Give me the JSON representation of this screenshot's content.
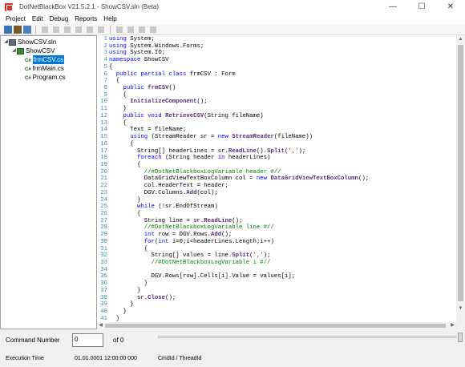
{
  "window": {
    "title": "DotNetBlackBox V21.5.2.1 - ShowCSV.sln (Beta)",
    "controls": {
      "minimize": "—",
      "maximize": "☐",
      "close": "✕"
    }
  },
  "menu": [
    "Project",
    "Edit",
    "Debug",
    "Reports",
    "Help"
  ],
  "toolbar": {
    "buttons": [
      {
        "name": "project-icon",
        "enabled": true
      },
      {
        "name": "open-folder-icon",
        "enabled": true
      },
      {
        "name": "export-icon",
        "enabled": true
      },
      {
        "name": "play-icon",
        "enabled": false
      },
      {
        "name": "step-icon",
        "enabled": false
      },
      {
        "name": "record-icon",
        "enabled": false
      },
      {
        "name": "step-over-icon",
        "enabled": false
      },
      {
        "name": "step-into-icon",
        "enabled": false
      },
      {
        "name": "step-out-icon",
        "enabled": false
      },
      {
        "name": "bookmark-icon",
        "enabled": false
      },
      {
        "name": "filter-icon",
        "enabled": false
      },
      {
        "name": "window-icon",
        "enabled": false
      },
      {
        "name": "pause-icon",
        "enabled": false
      }
    ]
  },
  "tree": {
    "nodes": [
      {
        "label": "ShowCSV.sln",
        "depth": 0,
        "type": "solution",
        "expander": "◢"
      },
      {
        "label": "ShowCSV",
        "depth": 1,
        "type": "project",
        "expander": "◢"
      },
      {
        "label": "frmCSV.cs",
        "depth": 2,
        "type": "cs",
        "selected": true
      },
      {
        "label": "frmMain.cs",
        "depth": 2,
        "type": "cs"
      },
      {
        "label": "Program.cs",
        "depth": 2,
        "type": "cs"
      }
    ]
  },
  "code": {
    "lines": [
      [
        [
          "kw",
          "using"
        ],
        [
          "nm",
          " System;"
        ]
      ],
      [
        [
          "kw",
          "using"
        ],
        [
          "nm",
          " System.Windows.Forms;"
        ]
      ],
      [
        [
          "kw",
          "using"
        ],
        [
          "nm",
          " System.IO;"
        ]
      ],
      [
        [
          "kw",
          "namespace"
        ],
        [
          "nm",
          " ShowCSV"
        ]
      ],
      [
        [
          "nm",
          "{"
        ]
      ],
      [
        [
          "nm",
          "  "
        ],
        [
          "kw",
          "public partial class"
        ],
        [
          "nm",
          " frmCSV : Form"
        ]
      ],
      [
        [
          "nm",
          "  {"
        ]
      ],
      [
        [
          "nm",
          "    "
        ],
        [
          "kw",
          "public"
        ],
        [
          "nm",
          " "
        ],
        [
          "fn",
          "frmCSV"
        ],
        [
          "nm",
          "()"
        ]
      ],
      [
        [
          "nm",
          "    {"
        ]
      ],
      [
        [
          "nm",
          "      "
        ],
        [
          "fn",
          "InitializeComponent"
        ],
        [
          "nm",
          "();"
        ]
      ],
      [
        [
          "nm",
          "    }"
        ]
      ],
      [
        [
          "nm",
          "    "
        ],
        [
          "kw",
          "public void"
        ],
        [
          "nm",
          " "
        ],
        [
          "fn",
          "RetrieveCSV"
        ],
        [
          "nm",
          "(String fileName)"
        ]
      ],
      [
        [
          "nm",
          "    {"
        ]
      ],
      [
        [
          "nm",
          "      Text = fileName;"
        ]
      ],
      [
        [
          "nm",
          "      "
        ],
        [
          "kw",
          "using"
        ],
        [
          "nm",
          " (StreamReader sr = "
        ],
        [
          "kw",
          "new"
        ],
        [
          "nm",
          " "
        ],
        [
          "fn",
          "StreamReader"
        ],
        [
          "nm",
          "(fileName))"
        ]
      ],
      [
        [
          "nm",
          "      {"
        ]
      ],
      [
        [
          "nm",
          "        String[] headerLines = sr."
        ],
        [
          "fn",
          "ReadLine"
        ],
        [
          "nm",
          "()."
        ],
        [
          "fn",
          "Split"
        ],
        [
          "nm",
          "("
        ],
        [
          "st",
          "','"
        ],
        [
          "nm",
          ");"
        ]
      ],
      [
        [
          "nm",
          "        "
        ],
        [
          "kw",
          "foreach"
        ],
        [
          "nm",
          " (String header "
        ],
        [
          "kw",
          "in"
        ],
        [
          "nm",
          " headerLines)"
        ]
      ],
      [
        [
          "nm",
          "        {"
        ]
      ],
      [
        [
          "nm",
          "          "
        ],
        [
          "cm",
          "//#DotNetBlackboxLogVariable header #//"
        ]
      ],
      [
        [
          "nm",
          "          DataGridViewTextBoxColumn col = "
        ],
        [
          "kw",
          "new"
        ],
        [
          "nm",
          " "
        ],
        [
          "fn",
          "DataGridViewTextBoxColumn"
        ],
        [
          "nm",
          "();"
        ]
      ],
      [
        [
          "nm",
          "          col.HeaderText = header;"
        ]
      ],
      [
        [
          "nm",
          "          DGV.Columns."
        ],
        [
          "fn",
          "Add"
        ],
        [
          "nm",
          "(col);"
        ]
      ],
      [
        [
          "nm",
          "        }"
        ]
      ],
      [
        [
          "nm",
          "        "
        ],
        [
          "kw",
          "while"
        ],
        [
          "nm",
          " (!sr.EndOfStream)"
        ]
      ],
      [
        [
          "nm",
          "        {"
        ]
      ],
      [
        [
          "nm",
          "          String line = sr."
        ],
        [
          "fn",
          "ReadLine"
        ],
        [
          "nm",
          "();"
        ]
      ],
      [
        [
          "nm",
          "          "
        ],
        [
          "cm",
          "//#DotNetBlackboxLogVariable line #//"
        ]
      ],
      [
        [
          "nm",
          "          "
        ],
        [
          "kw",
          "int"
        ],
        [
          "nm",
          " row = DGV.Rows."
        ],
        [
          "fn",
          "Add"
        ],
        [
          "nm",
          "();"
        ]
      ],
      [
        [
          "nm",
          "          "
        ],
        [
          "kw",
          "for"
        ],
        [
          "nm",
          "("
        ],
        [
          "kw",
          "int"
        ],
        [
          "nm",
          " i=0;i<headerLines.Length;i++)"
        ]
      ],
      [
        [
          "nm",
          "          {"
        ]
      ],
      [
        [
          "nm",
          "            String[] values = line."
        ],
        [
          "fn",
          "Split"
        ],
        [
          "nm",
          "("
        ],
        [
          "st",
          "','"
        ],
        [
          "nm",
          ");"
        ]
      ],
      [
        [
          "nm",
          "            "
        ],
        [
          "cm",
          "//#DotNetBlackboxLogVariable i #//"
        ]
      ],
      [
        [
          "nm",
          ""
        ]
      ],
      [
        [
          "nm",
          "            DGV.Rows[row].Cells[i].Value = values[i];"
        ]
      ],
      [
        [
          "nm",
          "          }"
        ]
      ],
      [
        [
          "nm",
          "        }"
        ]
      ],
      [
        [
          "nm",
          "        sr."
        ],
        [
          "fn",
          "Close"
        ],
        [
          "nm",
          "();"
        ]
      ],
      [
        [
          "nm",
          "      }"
        ]
      ],
      [
        [
          "nm",
          "    }"
        ]
      ],
      [
        [
          "nm",
          "  }"
        ]
      ]
    ]
  },
  "bottom": {
    "command_number_label": "Command Number",
    "command_number_value": "0",
    "of_label": "of 0",
    "slider_position_fraction": 1.0,
    "execution_time_label": "Execution Time",
    "execution_time_value": "01.01.0001 12:00:00 000",
    "cmdid_label": "CmdId / ThreadId"
  },
  "scrollbar": {
    "up": "▲",
    "down": "▼",
    "left": "◀",
    "right": "▶"
  }
}
